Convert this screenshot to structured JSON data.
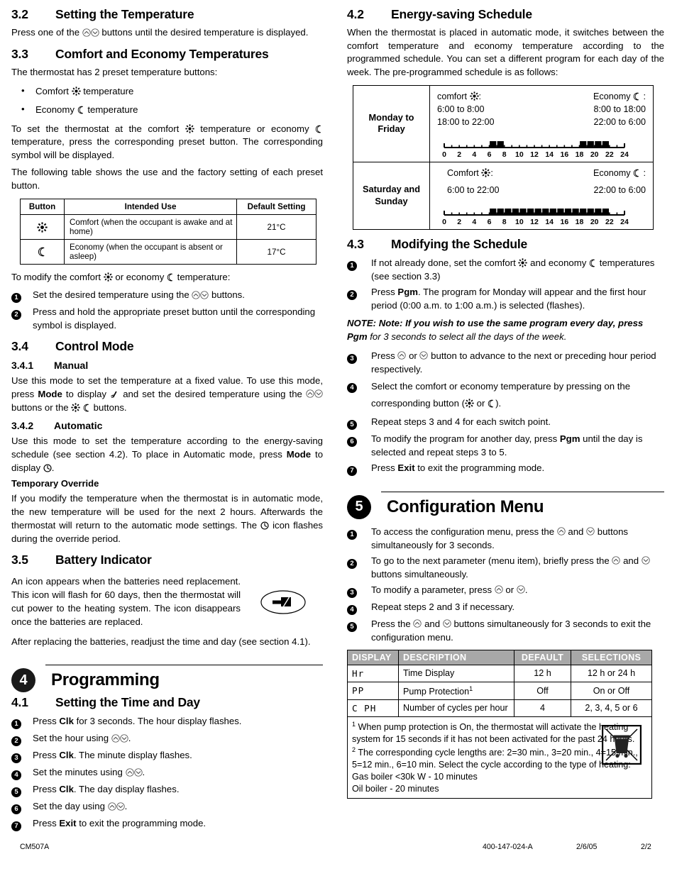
{
  "document": {
    "footer": {
      "model": "CM507A",
      "part_number": "400-147-024-A",
      "date": "2/6/05",
      "page": "2/2"
    }
  },
  "left_column": {
    "s32": {
      "number": "3.2",
      "title": "Setting the Temperature",
      "body_a": "Press one of the",
      "body_b": "buttons until the desired temperature is displayed."
    },
    "s33": {
      "number": "3.3",
      "title": "Comfort and Economy Temperatures",
      "intro": "The thermostat has 2 preset temperature buttons:",
      "bullets": [
        {
          "pre": "Comfort",
          "post": "temperature",
          "icon": "sun-icon"
        },
        {
          "pre": "Economy",
          "post": "temperature",
          "icon": "moon-icon"
        }
      ],
      "para_a": "To set the thermostat at the comfort",
      "para_b": "temperature or economy",
      "para_c": "temperature, press the corresponding preset button. The corresponding symbol will be displayed.",
      "para_d": "The following table shows the use and the factory setting of each preset button.",
      "table": {
        "headers": [
          "Button",
          "Intended Use",
          "Default Setting"
        ],
        "rows": [
          {
            "icon": "sun-icon",
            "use": "Comfort (when the occupant is awake and at home)",
            "default": "21°C"
          },
          {
            "icon": "moon-icon",
            "use": "Economy (when the occupant is absent or asleep)",
            "default": "17°C"
          }
        ]
      },
      "modify_a": "To modify the comfort",
      "modify_b": "or economy",
      "modify_c": "temperature:",
      "steps": [
        {
          "n": "1",
          "a": "Set the desired temperature using the",
          "b": "buttons."
        },
        {
          "n": "2",
          "a": "Press and hold the appropriate preset button until the corresponding symbol is displayed.",
          "b": ""
        }
      ]
    },
    "s34": {
      "number": "3.4",
      "title": "Control Mode",
      "manual": {
        "number": "3.4.1",
        "title": "Manual",
        "a": "Use this mode to set the temperature at a fixed value. To use this mode, press",
        "mode_kw": "Mode",
        "b": "to display",
        "c": "and set the desired temperature using the",
        "d": "buttons or the",
        "e": "buttons."
      },
      "automatic": {
        "number": "3.4.2",
        "title": "Automatic",
        "a": "Use this mode to set the temperature according to the energy-saving schedule (see section 4.2). To place in Automatic mode, press",
        "mode_kw": "Mode",
        "b": "to display",
        "c": ".",
        "override_title": "Temporary Override",
        "override_a": "If you modify the temperature when the thermostat is in automatic mode, the new temperature will be used for the next 2 hours. Afterwards the thermostat will return to the automatic mode settings. The",
        "override_b": "icon flashes during the override period."
      }
    },
    "s35": {
      "number": "3.5",
      "title": "Battery Indicator",
      "para_a": "An icon appears when the batteries need replacement. This icon will flash for 60 days, then the thermostat will cut power to the heating system. The icon disappears once the batteries are replaced.",
      "para_b": "After replacing the batteries, readjust the time and day (see section 4.1)."
    },
    "ch4": {
      "badge": "4",
      "title": "Programming",
      "s41": {
        "number": "4.1",
        "title": "Setting the Time and Day",
        "steps": [
          {
            "n": "1",
            "pre": "Press",
            "kw": "Clk",
            "post": "for 3 seconds. The hour display flashes."
          },
          {
            "n": "2",
            "pre": "Set the hour using",
            "kw": "",
            "post": "."
          },
          {
            "n": "3",
            "pre": "Press",
            "kw": "Clk",
            "post": ". The minute display flashes."
          },
          {
            "n": "4",
            "pre": "Set the minutes using",
            "kw": "",
            "post": "."
          },
          {
            "n": "5",
            "pre": "Press",
            "kw": "Clk",
            "post": ". The day display flashes."
          },
          {
            "n": "6",
            "pre": "Set the day using",
            "kw": "",
            "post": "."
          },
          {
            "n": "7",
            "pre": "Press",
            "kw": "Exit",
            "post": "to exit the programming mode."
          }
        ]
      }
    }
  },
  "right_column": {
    "s42": {
      "number": "4.2",
      "title": "Energy-saving Schedule",
      "body": "When the thermostat is placed in automatic mode, it switches between the comfort temperature and economy temperature according to the programmed schedule. You can set a different program for each day of the week. The pre-programmed schedule is as follows:",
      "rows": [
        {
          "day": "Monday to Friday",
          "comfort_label": "comfort",
          "economy_label": "Economy",
          "comfort_times": [
            "6:00 to 8:00",
            "18:00 to 22:00"
          ],
          "economy_times": [
            "8:00 to 18:00",
            "22:00 to 6:00"
          ],
          "ticks": [
            "0",
            "2",
            "4",
            "6",
            "8",
            "10",
            "12",
            "14",
            "16",
            "18",
            "20",
            "22",
            "24"
          ],
          "comfort_blocks": [
            [
              6,
              8
            ],
            [
              18,
              22
            ]
          ]
        },
        {
          "day": "Saturday and Sunday",
          "comfort_label": "Comfort",
          "economy_label": "Economy",
          "comfort_times": [
            "6:00 to 22:00"
          ],
          "economy_times": [
            "22:00 to 6:00"
          ],
          "ticks": [
            "0",
            "2",
            "4",
            "6",
            "8",
            "10",
            "12",
            "14",
            "16",
            "18",
            "20",
            "22",
            "24"
          ],
          "comfort_blocks": [
            [
              6,
              22
            ]
          ]
        }
      ]
    },
    "s43": {
      "number": "4.3",
      "title": "Modifying the Schedule",
      "step1_a": "If not already done, set the comfort",
      "step1_b": "and economy",
      "step1_c": "temperatures (see section 3.3)",
      "step2_a": "Press",
      "step2_kw": "Pgm",
      "step2_b": ". The program for Monday will appear and the first hour period (0:00 a.m. to 1:00 a.m.) is selected (flashes).",
      "note_a": "NOTE: Note: If you wish to use the same program every day, press",
      "note_kw": "Pgm",
      "note_b": "for 3 seconds to select all the days of the week.",
      "step3_a": "Press",
      "step3_b": "or",
      "step3_c": "button to advance to the next or preceding hour period respectively.",
      "step4_a": "Select the comfort or economy temperature by pressing on the corresponding button (",
      "step4_b": "or",
      "step4_c": ").",
      "step5": "Repeat steps 3 and 4 for each switch point.",
      "step6_a": "To modify the program for another day, press",
      "step6_kw": "Pgm",
      "step6_b": "until the day is selected and repeat steps 3 to 5.",
      "step7_a": "Press",
      "step7_kw": "Exit",
      "step7_b": "to exit the programming mode."
    },
    "ch5": {
      "badge": "5",
      "title": "Configuration Menu",
      "steps": [
        {
          "n": "1",
          "a": "To access the configuration menu, press the",
          "b": "and",
          "c": "buttons simultaneously for 3 seconds."
        },
        {
          "n": "2",
          "a": "To go to the next parameter (menu item), briefly press the",
          "b": "and",
          "c": "buttons simultaneously."
        },
        {
          "n": "3",
          "a": "To modify a parameter, press",
          "b": "or",
          "c": "."
        },
        {
          "n": "4",
          "a": "Repeat steps 2 and 3 if necessary.",
          "b": "",
          "c": ""
        },
        {
          "n": "5",
          "a": "Press the",
          "b": "and",
          "c": "buttons simultaneously for 3 seconds to exit the configuration menu."
        }
      ],
      "table": {
        "headers": [
          "DISPLAY",
          "DESCRIPTION",
          "DEFAULT",
          "SELECTIONS"
        ],
        "rows": [
          {
            "display": "Hr",
            "description": "Time Display",
            "footnote": "",
            "default": "12 h",
            "selections": "12 h or 24 h"
          },
          {
            "display": "PP",
            "description": "Pump Protection",
            "footnote": "1",
            "default": "Off",
            "selections": "On or Off"
          },
          {
            "display": "C PH",
            "description": "Number of cycles per hour",
            "footnote": "",
            "default": "4",
            "selections": "2, 3, 4, 5 or 6"
          }
        ],
        "footnotes": [
          {
            "mark": "1",
            "text": "When pump protection is On, the thermostat will activate the heating system for 15 seconds if it has not been activated for the past 24 hours."
          },
          {
            "mark": "2",
            "text": "The corresponding cycle lengths are: 2=30 min., 3=20 min., 4=15 min., 5=12 min., 6=10 min. Select the cycle according to the type of heating:"
          }
        ],
        "footnote_extra": [
          "Gas boiler <30k W - 10 minutes",
          "Oil boiler - 20 minutes"
        ]
      }
    }
  },
  "icons": {
    "sun": "sun-icon",
    "moon": "moon-icon",
    "up_button": "circle-up-button-icon",
    "down_button": "circle-down-button-icon",
    "clock": "clock-icon",
    "hand": "manual-hand-icon",
    "battery": "battery-low-icon",
    "weee": "weee-crossed-bin-icon"
  },
  "colors": {
    "text": "#000000",
    "background": "#ffffff",
    "table_header_bg": "#a8a8a8",
    "table_header_fg": "#ffffff"
  }
}
